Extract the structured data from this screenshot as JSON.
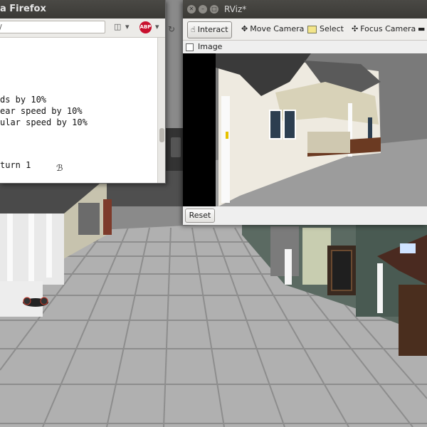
{
  "firefox": {
    "title": "a Firefox",
    "url_text": "/",
    "terminal_lines": [
      "ds by 10%",
      "ear speed by 10%",
      "ular speed by 10%",
      "turn 1"
    ]
  },
  "rviz": {
    "title": "RViz*",
    "toolbar": {
      "interact": "Interact",
      "move_camera": "Move Camera",
      "select": "Select",
      "focus_camera": "Focus Camera"
    },
    "panel_title": "Image",
    "reset_label": "Reset"
  },
  "icons": {
    "abp": "ABP"
  }
}
